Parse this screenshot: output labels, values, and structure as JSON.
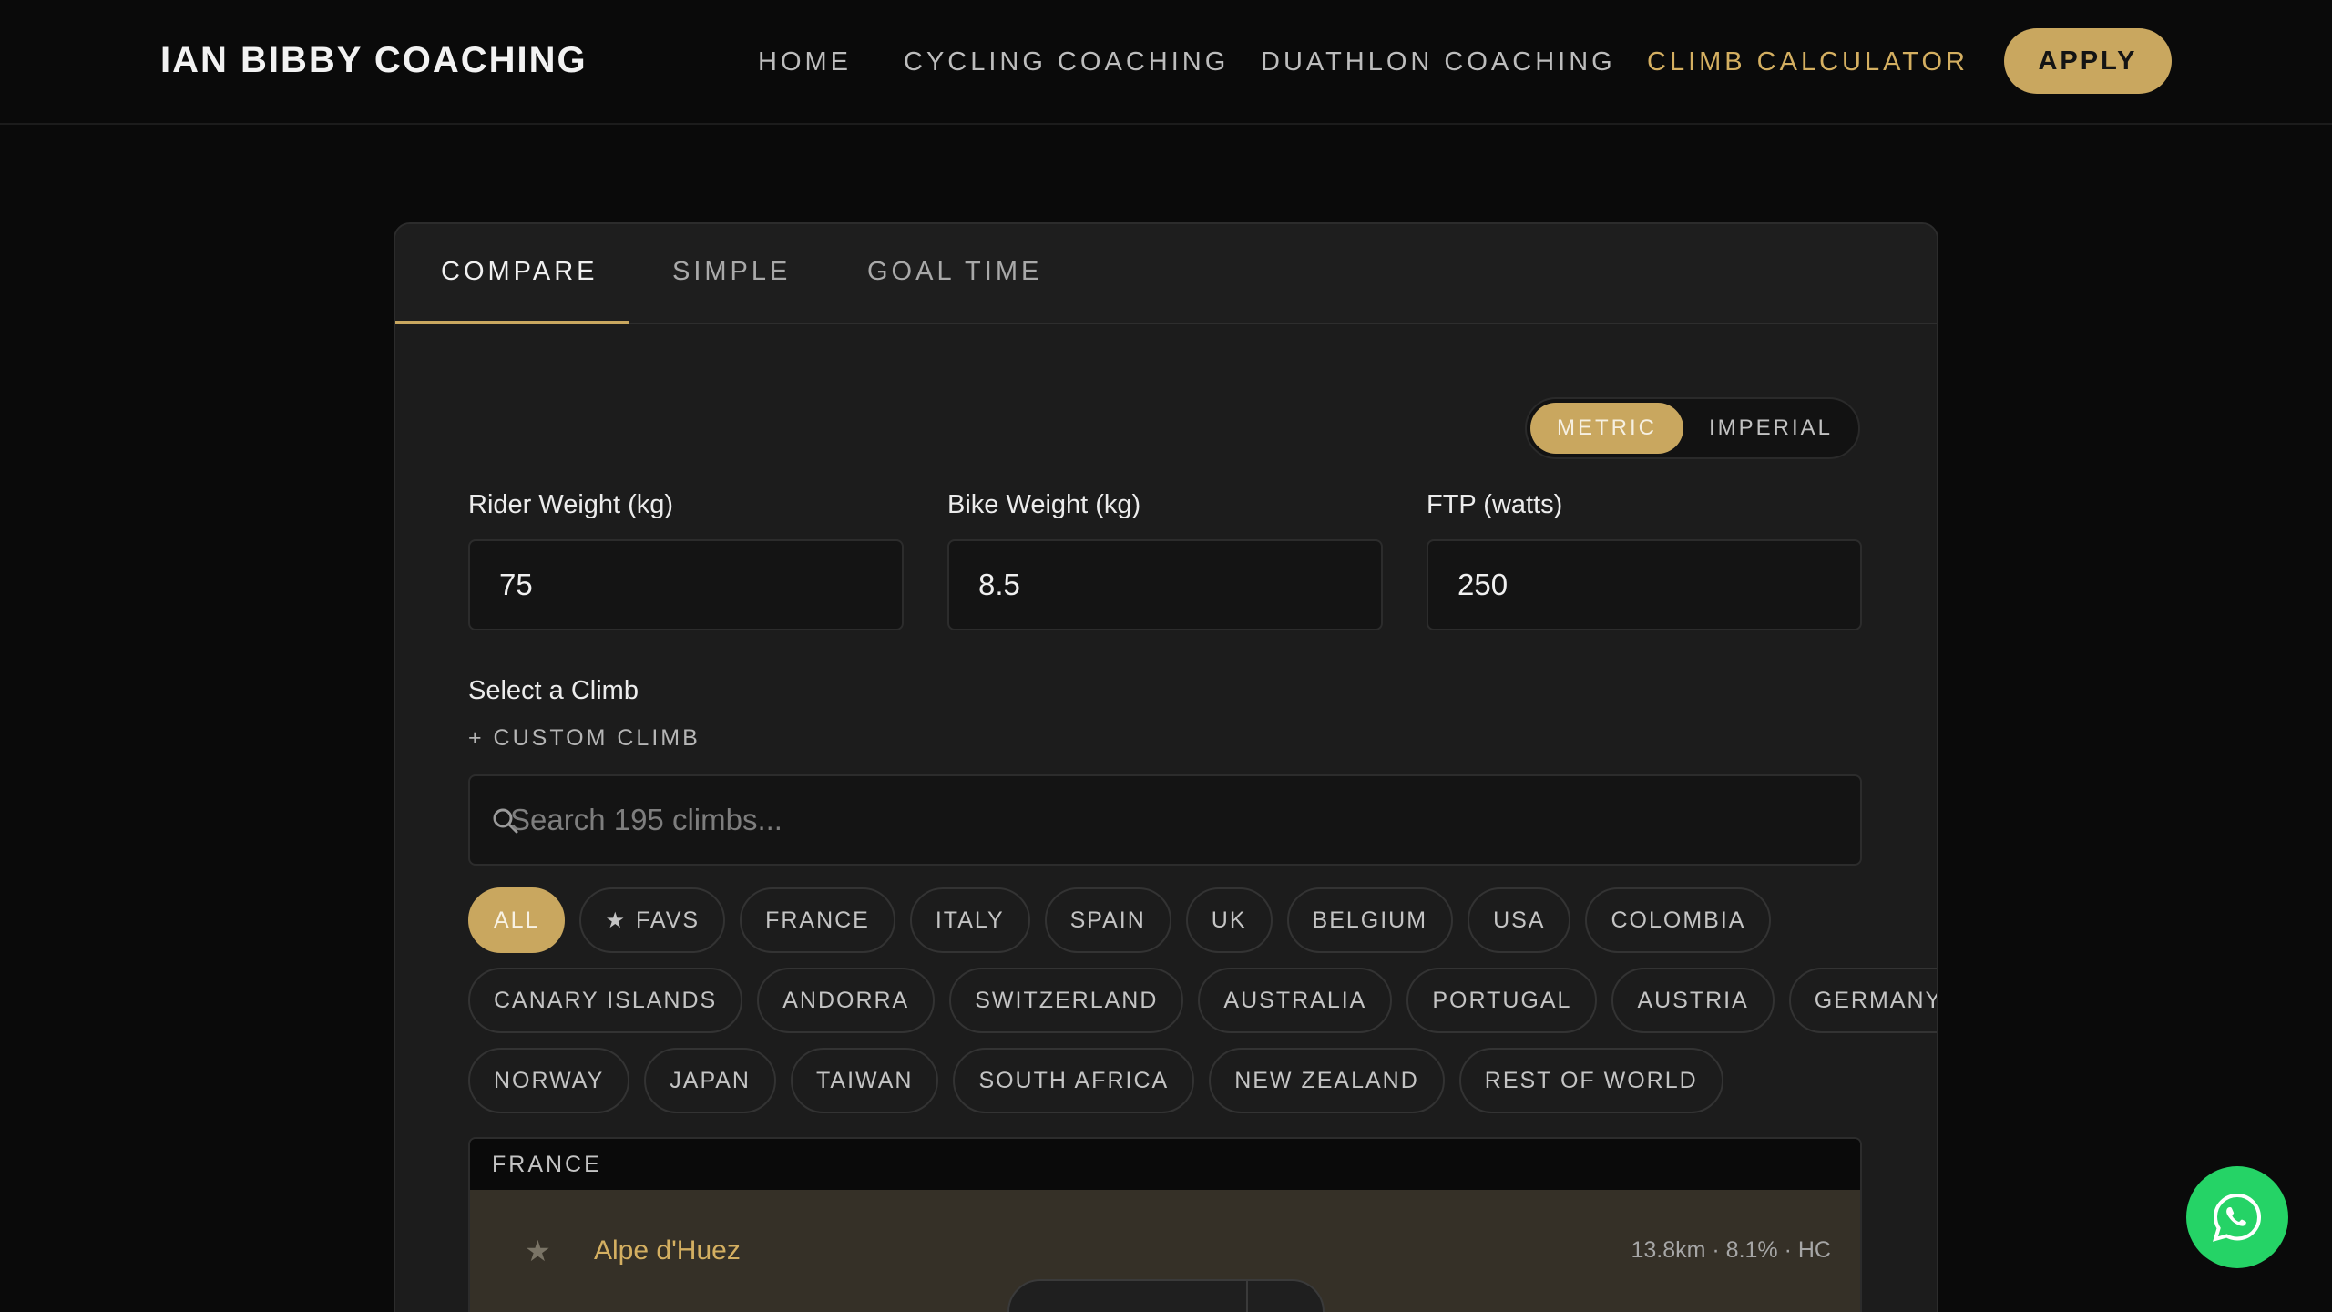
{
  "header": {
    "brand": "IAN BIBBY COACHING",
    "nav": [
      {
        "label": "HOME"
      },
      {
        "label": "CYCLING COACHING"
      },
      {
        "label": "DUATHLON COACHING"
      },
      {
        "label": "CLIMB CALCULATOR",
        "active": true
      }
    ],
    "apply_label": "APPLY"
  },
  "tabs": [
    {
      "label": "COMPARE",
      "active": true
    },
    {
      "label": "SIMPLE"
    },
    {
      "label": "GOAL TIME"
    }
  ],
  "units": {
    "metric": "METRIC",
    "imperial": "IMPERIAL",
    "selected": "METRIC"
  },
  "fields": {
    "rider_weight": {
      "label": "Rider Weight (kg)",
      "value": "75"
    },
    "bike_weight": {
      "label": "Bike Weight (kg)",
      "value": "8.5"
    },
    "ftp": {
      "label": "FTP (watts)",
      "value": "250"
    }
  },
  "select_climb": {
    "label": "Select a Climb",
    "custom_label": "+ CUSTOM CLIMB",
    "search_placeholder": "Search 195 climbs..."
  },
  "chips": {
    "row1": [
      "ALL",
      "FAVS",
      "FRANCE",
      "ITALY",
      "SPAIN",
      "UK",
      "BELGIUM",
      "USA",
      "COLOMBIA"
    ],
    "row2": [
      "CANARY ISLANDS",
      "ANDORRA",
      "SWITZERLAND",
      "AUSTRALIA",
      "PORTUGAL",
      "AUSTRIA",
      "GERMANY"
    ],
    "row3": [
      "NORWAY",
      "JAPAN",
      "TAIWAN",
      "SOUTH AFRICA",
      "NEW ZEALAND",
      "REST OF WORLD"
    ],
    "active": "ALL"
  },
  "climb_list": {
    "group": "FRANCE",
    "items": [
      {
        "name": "Alpe d'Huez",
        "meta": "13.8km · 8.1% · HC"
      }
    ]
  },
  "colors": {
    "accent": "#c9a75f",
    "background": "#0a0a0a",
    "card": "#1c1c1c",
    "whatsapp": "#25d366"
  },
  "icons": {
    "search": "search-icon",
    "star": "star-icon",
    "whatsapp": "whatsapp-icon"
  }
}
